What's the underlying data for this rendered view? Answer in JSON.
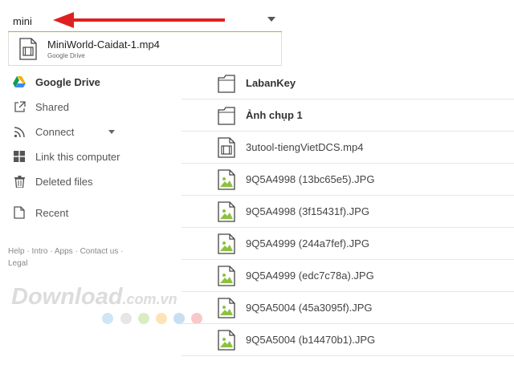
{
  "search": {
    "value": "mini"
  },
  "suggestion": {
    "name": "MiniWorld-Caidat-1.mp4",
    "source": "Google Drive"
  },
  "sidebar": {
    "items": [
      {
        "label": "Google Drive",
        "icon": "google-drive-icon",
        "active": true
      },
      {
        "label": "Shared",
        "icon": "shared-icon"
      },
      {
        "label": "Connect",
        "icon": "connect-icon"
      },
      {
        "label": "Link this computer",
        "icon": "windows-icon"
      },
      {
        "label": "Deleted files",
        "icon": "trash-icon"
      },
      {
        "label": "Recent",
        "icon": "recent-icon"
      }
    ]
  },
  "footer": {
    "help": "Help",
    "intro": "Intro",
    "apps": "Apps",
    "contact": "Contact us",
    "legal": "Legal",
    "separator": "·"
  },
  "watermark": {
    "main": "Download",
    "suffix": ".com.vn"
  },
  "files": [
    {
      "name": "LabanKey",
      "type": "folder"
    },
    {
      "name": "Ảnh chụp 1",
      "type": "folder"
    },
    {
      "name": "3utool-tiengVietDCS.mp4",
      "type": "video"
    },
    {
      "name": "9Q5A4998 (13bc65e5).JPG",
      "type": "image"
    },
    {
      "name": "9Q5A4998 (3f15431f).JPG",
      "type": "image"
    },
    {
      "name": "9Q5A4999 (244a7fef).JPG",
      "type": "image"
    },
    {
      "name": "9Q5A4999 (edc7c78a).JPG",
      "type": "image"
    },
    {
      "name": "9Q5A5004 (45a3095f).JPG",
      "type": "image"
    },
    {
      "name": "9Q5A5004 (b14470b1).JPG",
      "type": "image"
    }
  ],
  "colors": {
    "accent": "#8ec13f",
    "arrow": "#e02020",
    "dots": [
      "#cfe6f7",
      "#e6e6e6",
      "#d9ecc4",
      "#fde3b8",
      "#c8dff2",
      "#f7c9c9"
    ]
  }
}
